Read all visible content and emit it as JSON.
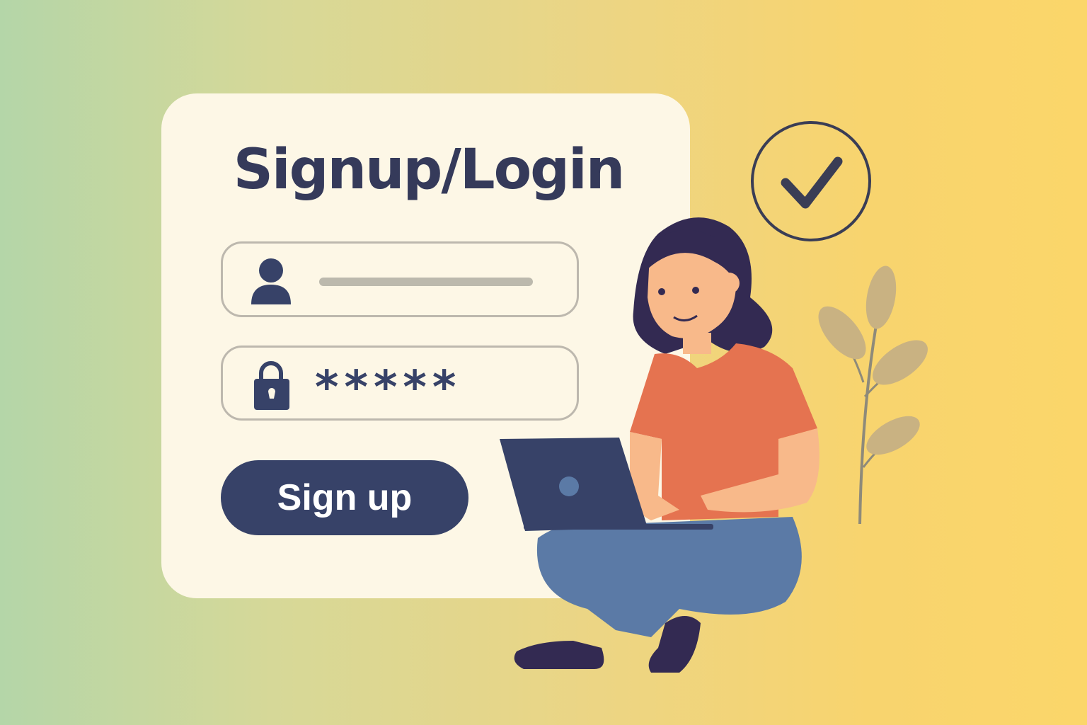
{
  "card": {
    "title": "Signup/Login",
    "username_field": {
      "icon": "user-icon",
      "value": ""
    },
    "password_field": {
      "icon": "lock-icon",
      "value": "*****"
    },
    "signup_button": {
      "label": "Sign up"
    }
  },
  "decor": {
    "check_icon": "check-circle-icon"
  },
  "colors": {
    "primary": "#374268",
    "card": "#fdf7e6",
    "shirt": "#e57350",
    "jeans": "#5b7aa6"
  }
}
